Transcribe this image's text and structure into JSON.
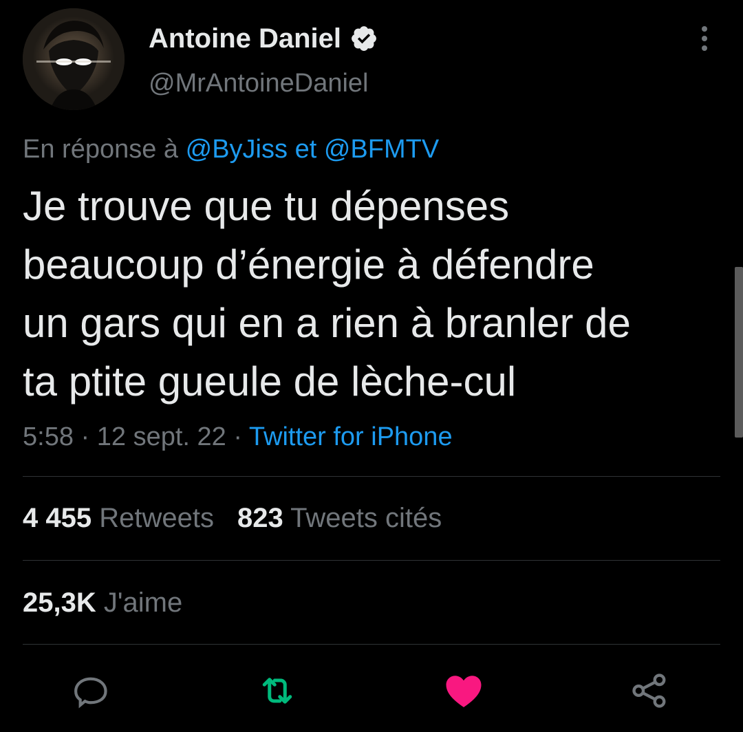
{
  "author": {
    "name": "Antoine Daniel",
    "handle": "@MrAntoineDaniel"
  },
  "reply_to": {
    "prefix": "En réponse à",
    "user1": "@ByJiss",
    "conjunction": "et",
    "user2": "@BFMTV"
  },
  "tweet": {
    "lines": [
      "Je trouve que tu dépenses",
      "beaucoup d’énergie à défendre",
      "un gars qui en a rien à branler de",
      "ta ptite gueule de lèche-cul"
    ]
  },
  "meta": {
    "time": "5:58",
    "sep1": "·",
    "date": "12 sept. 22",
    "sep2": "·",
    "source": "Twitter for iPhone"
  },
  "stats": {
    "retweets_count": "4 455",
    "retweets_label": "Retweets",
    "quotes_count": "823",
    "quotes_label": "Tweets cités",
    "likes_count": "25,3K",
    "likes_label": "J'aime"
  },
  "colors": {
    "background": "#000000",
    "text": "#e7e9ea",
    "secondary": "#71767b",
    "link": "#1d9bf0",
    "retweet": "#00ba7c",
    "like": "#f91880"
  },
  "icons": {
    "reply": "reply-icon",
    "retweet": "retweet-icon",
    "like": "heart-icon",
    "share": "share-icon",
    "more": "more-icon",
    "verified": "verified-badge-icon"
  }
}
